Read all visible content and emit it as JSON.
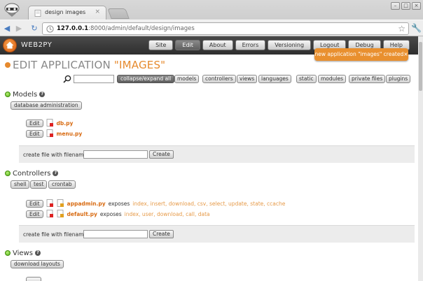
{
  "browser": {
    "tab_title": "design images",
    "tab_close": "×",
    "url_host": "127.0.0.1",
    "url_path": ":8000/admin/default/design/images",
    "window_controls": [
      "–",
      "□",
      "×"
    ]
  },
  "header": {
    "logo": "WEB2PY",
    "nav": [
      "Site",
      "Edit",
      "About",
      "Errors",
      "Versioning",
      "Logout",
      "Debug",
      "Help"
    ],
    "active_nav": "Edit"
  },
  "flash": "new application \"images\" created×",
  "title": {
    "prefix": "EDIT APPLICATION ",
    "app": "\"IMAGES\""
  },
  "toolbar": {
    "collapse_label": "collapse/expand all",
    "sections": [
      "models",
      "controllers",
      "views",
      "languages",
      "static",
      "modules",
      "private files",
      "plugins"
    ]
  },
  "models": {
    "title": "Models",
    "help": "?",
    "db_admin": "database administration",
    "files": [
      {
        "edit": "Edit",
        "name": "db.py"
      },
      {
        "edit": "Edit",
        "name": "menu.py"
      }
    ],
    "create_label": "create file with filename:",
    "create_btn": "Create"
  },
  "controllers": {
    "title": "Controllers",
    "help": "?",
    "buttons": [
      "shell",
      "test",
      "crontab"
    ],
    "files": [
      {
        "edit": "Edit",
        "name": "appadmin.py",
        "exposes": "exposes",
        "functions": "index, insert, download, csv, select, update, state, ccache"
      },
      {
        "edit": "Edit",
        "name": "default.py",
        "exposes": "exposes",
        "functions": "index, user, download, call, data"
      }
    ],
    "create_label": "create file with filename:",
    "create_btn": "Create"
  },
  "views": {
    "title": "Views",
    "help": "?",
    "download_layouts": "download layouts"
  },
  "colors": {
    "accent": "#e68a2e",
    "green": "#55b314"
  }
}
